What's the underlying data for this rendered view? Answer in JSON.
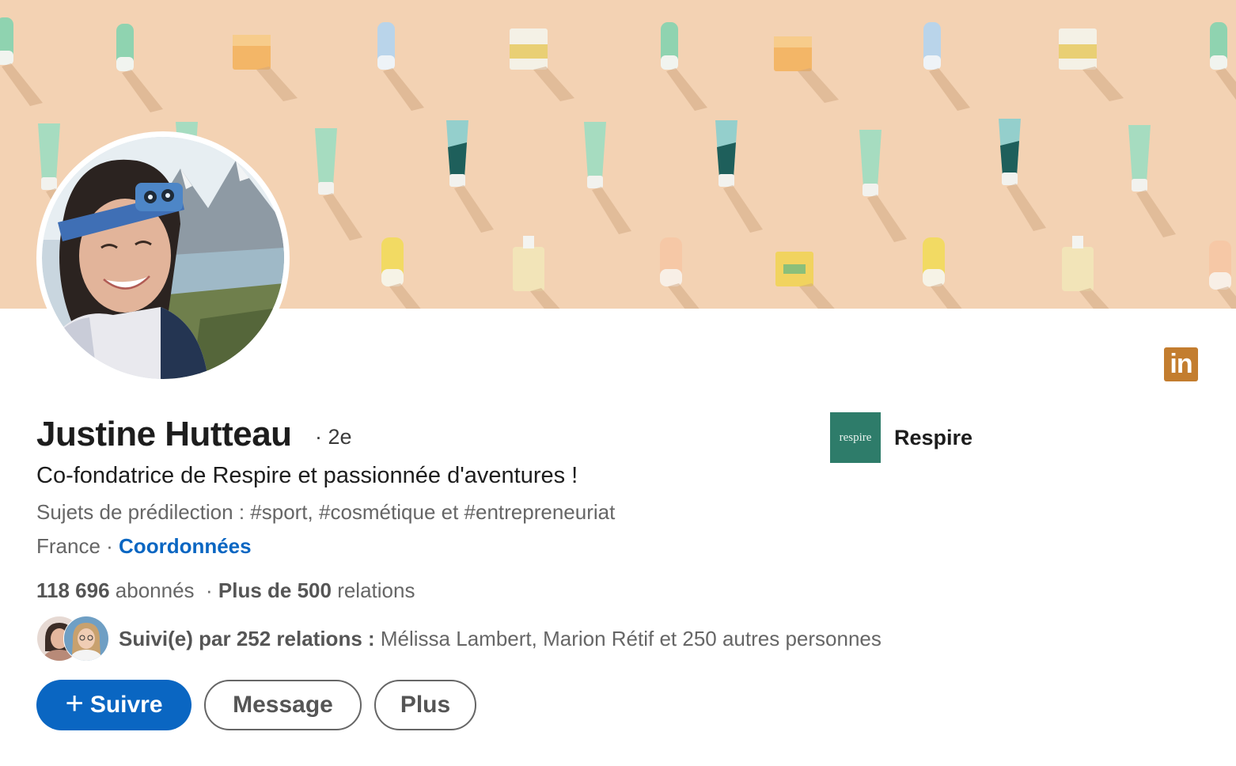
{
  "profile": {
    "name": "Justine Hutteau",
    "degree": "· 2e",
    "headline": "Co-fondatrice de Respire et passionnée d'aventures !",
    "topics": "Sujets de prédilection : #sport, #cosmétique et #entrepreneuriat",
    "location": "France · ",
    "contact_link": "Coordonnées",
    "followers_count": "118 696",
    "followers_label": " abonnés",
    "separator": "  · ",
    "connections_count": "Plus de 500",
    "connections_label": " relations"
  },
  "company": {
    "logo_text": "respire",
    "name": "Respire",
    "logo_color": "#2e7c6a"
  },
  "followed_by": {
    "lead": "Suivi(e) par 252 relations : ",
    "names": "Mélissa Lambert, Marion Rétif et 250 autres personnes"
  },
  "actions": {
    "follow_icon": "+",
    "follow_label": "Suivre",
    "message_label": "Message",
    "more_label": "Plus"
  },
  "badge": {
    "label": "in",
    "icon": "linkedin-icon",
    "color": "#c37d2f"
  },
  "colors": {
    "primary": "#0a66c2",
    "banner_bg": "#f3d2b3"
  }
}
